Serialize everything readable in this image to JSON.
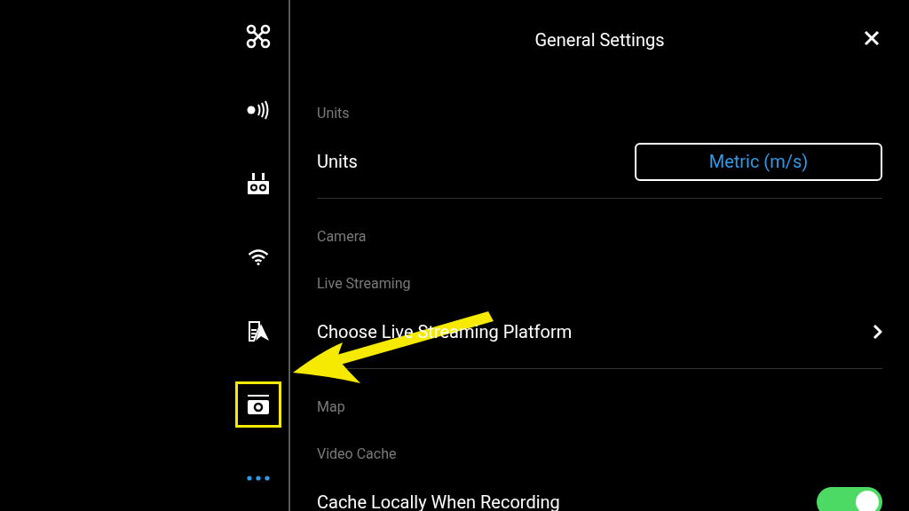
{
  "sidebar": {
    "items": [
      {
        "kind": "drone",
        "highlighted": false
      },
      {
        "kind": "signal",
        "highlighted": false
      },
      {
        "kind": "remote",
        "highlighted": false
      },
      {
        "kind": "wifi",
        "highlighted": false
      },
      {
        "kind": "battery-nav",
        "highlighted": false
      },
      {
        "kind": "camera",
        "highlighted": true
      },
      {
        "kind": "more",
        "highlighted": false
      }
    ]
  },
  "panel": {
    "title": "General Settings",
    "sections": [
      {
        "header": "Units",
        "rows": [
          {
            "kind": "select",
            "label": "Units",
            "value": "Metric (m/s)"
          }
        ]
      },
      {
        "header": "Camera"
      },
      {
        "header": "Live Streaming",
        "rows": [
          {
            "kind": "link",
            "label": "Choose Live Streaming Platform"
          }
        ]
      },
      {
        "header": "Map"
      },
      {
        "header": "Video Cache",
        "rows": [
          {
            "kind": "toggle",
            "label": "Cache Locally When Recording",
            "on": true
          }
        ]
      }
    ]
  },
  "annotations": [
    {
      "kind": "arrow",
      "color": "#f5ea00"
    }
  ]
}
